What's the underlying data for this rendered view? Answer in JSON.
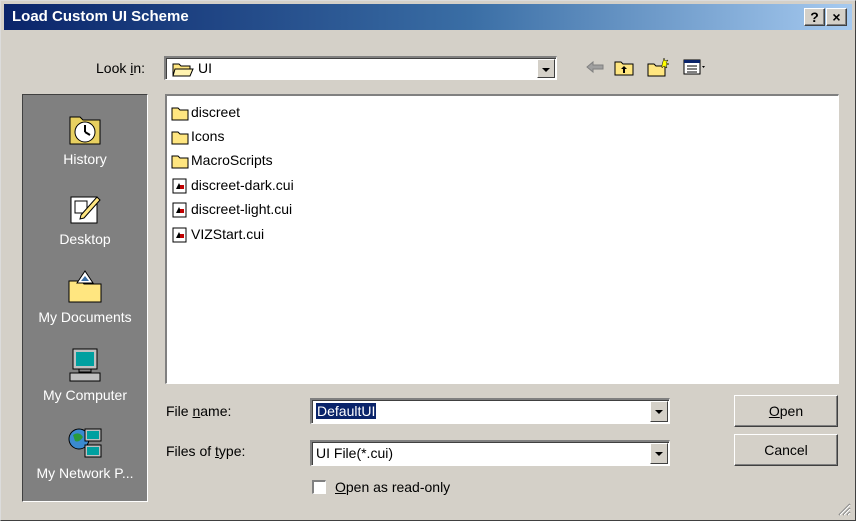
{
  "window": {
    "title": "Load Custom UI Scheme",
    "help_button": "?",
    "close_button": "×"
  },
  "look_in": {
    "label_prefix": "Look ",
    "label_key": "i",
    "label_suffix": "n:",
    "value": "UI"
  },
  "places": [
    {
      "label": "History",
      "icon": "history-icon"
    },
    {
      "label": "Desktop",
      "icon": "desktop-icon"
    },
    {
      "label": "My Documents",
      "icon": "my-documents-icon"
    },
    {
      "label": "My Computer",
      "icon": "my-computer-icon"
    },
    {
      "label": "My Network P...",
      "icon": "network-places-icon"
    }
  ],
  "files": [
    {
      "name": "discreet",
      "type": "folder"
    },
    {
      "name": "Icons",
      "type": "folder"
    },
    {
      "name": "MacroScripts",
      "type": "folder"
    },
    {
      "name": "discreet-dark.cui",
      "type": "file"
    },
    {
      "name": "discreet-light.cui",
      "type": "file"
    },
    {
      "name": "VIZStart.cui",
      "type": "file"
    }
  ],
  "file_name": {
    "label_prefix": "File ",
    "label_key": "n",
    "label_suffix": "ame:",
    "value": "DefaultUI"
  },
  "file_type": {
    "label_prefix": "Files of ",
    "label_key": "t",
    "label_suffix": "ype:",
    "value": "UI File(*.cui)"
  },
  "read_only": {
    "label_key": "O",
    "label_suffix": "pen as read-only",
    "checked": false
  },
  "buttons": {
    "open_key": "O",
    "open_suffix": "pen",
    "cancel": "Cancel"
  },
  "toolbar": [
    "back-arrow-icon",
    "up-folder-icon",
    "new-folder-icon",
    "view-menu-icon"
  ],
  "colors": {
    "title_start": "#0a246a",
    "title_end": "#a6caf0",
    "selection": "#0a246a",
    "face": "#d4d0c8"
  }
}
